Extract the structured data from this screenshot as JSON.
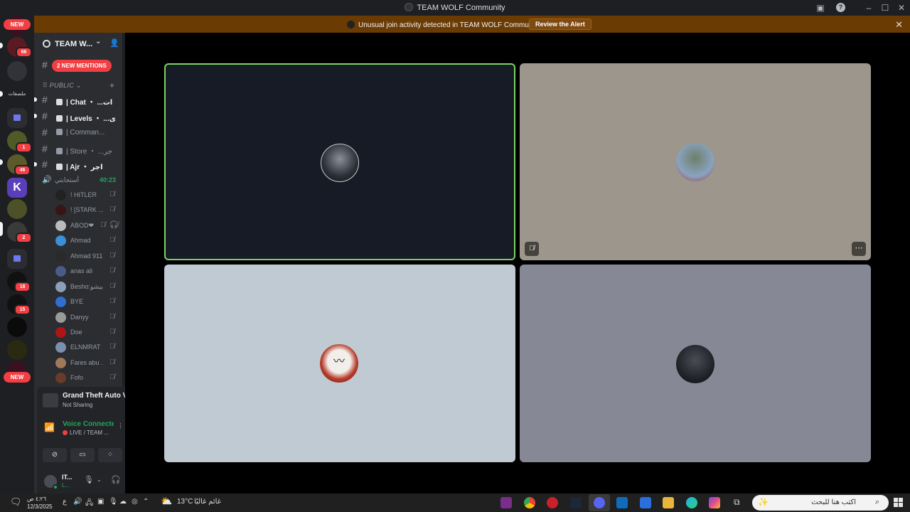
{
  "window": {
    "title": "TEAM WOLF Community"
  },
  "alert": {
    "message": "Unusual join activity detected in TEAM WOLF Community",
    "button": "Review the Alert"
  },
  "rail": {
    "new_top": "NEW",
    "new_bottom": "NEW",
    "badge_66": "66",
    "folder_label": "ملصقات",
    "badge_1": "1",
    "badge_46": "46",
    "badge_2": "2",
    "badge_18": "18",
    "badge_15": "15"
  },
  "guild": {
    "name": "TEAM W...",
    "mentions": "2 NEW MENTIONS",
    "category": "PUBLIC",
    "channels": [
      {
        "label": "| Chat ・ ...ات",
        "unread": true
      },
      {
        "label": "| Levels ・ ...ى",
        "unread": true
      },
      {
        "label": "| Comman...",
        "unread": false
      },
      {
        "label": "| Store ・ ...جر",
        "unread": false
      },
      {
        "label": "| Ajr ・ اجر",
        "unread": true
      }
    ],
    "voice": {
      "name": "أستجابتي",
      "elapsed": "40:23"
    },
    "voice_users": [
      "! HITLER",
      "! [STARK ...",
      "ABOD❤",
      "Ahmad",
      "Ahmad 911",
      "anas ali",
      "Besho:بيشو",
      "BYE",
      "Danyy",
      "Doe",
      "ELNMRAT",
      "Fares abu ...",
      "Fofo"
    ]
  },
  "activity": {
    "game": "Grand Theft Auto V...",
    "status": "Not Sharing"
  },
  "voice_panel": {
    "title": "Voice Connected",
    "channel": "LIVE / TEAM ..."
  },
  "user": {
    "name": "IT...",
    "sub": "L..."
  },
  "taskbar": {
    "time": "٤:٢٦ ص",
    "date": "12/3/2025",
    "lang": "ع",
    "weather_temp": "13°C",
    "weather_text": "غائم غالبًا",
    "search_placeholder": "اكتب هنا للبحث"
  },
  "colors": {
    "speaking_border": "#7bd35f",
    "tile1_bg": "#161b26",
    "tile2_bg": "#9c968c",
    "tile3_bg": "#c0cad3",
    "tile4_bg": "#868995",
    "alert_bg": "#6b3b04",
    "voice_green": "#23a55a",
    "badge_red": "#f23f43"
  },
  "icons": [
    "wolf-avatar-icon",
    "mustache-avatar-icon",
    "black-wolf-avatar-icon",
    "person-avatar-icon",
    "mute-icon",
    "more-icon",
    "speaker-icon",
    "signal-icon",
    "settings-icon",
    "headphones-icon",
    "mic-icon"
  ]
}
